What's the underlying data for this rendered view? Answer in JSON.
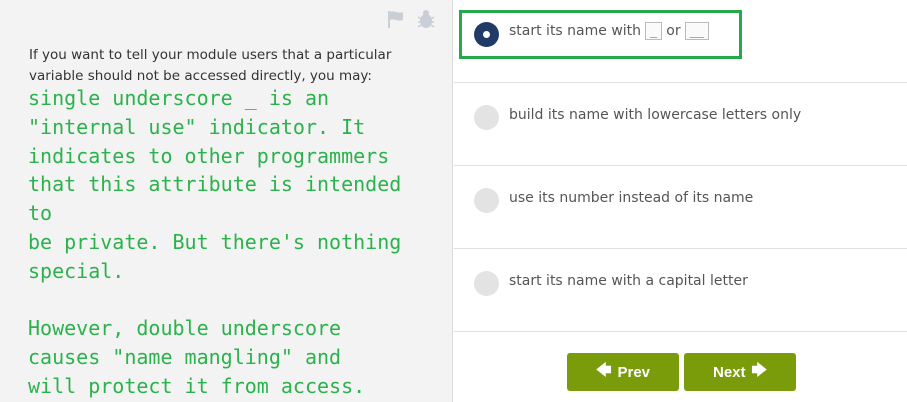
{
  "question": {
    "text": "If you want to tell your module users that a particular variable should not be accessed directly, you may:"
  },
  "annotation": {
    "text": "single underscore _ is an\n\"internal use\" indicator. It\nindicates to other programmers\nthat this attribute is intended to\nbe private. But there's nothing\nspecial.\n\nHowever, double underscore\ncauses \"name mangling\" and\nwill protect it from access.",
    "color": "#2bb24c"
  },
  "toolbar": {
    "flag_icon": "flag-icon",
    "bug_icon": "bug-icon"
  },
  "options": [
    {
      "label": "start its name with",
      "code1": "_",
      "joiner": "or",
      "code2": "__",
      "selected": true
    },
    {
      "label": "build its name with lowercase letters only",
      "selected": false
    },
    {
      "label": "use its number instead of its name",
      "selected": false
    },
    {
      "label": "start its name with a capital letter",
      "selected": false
    }
  ],
  "nav": {
    "prev_label": "Prev",
    "next_label": "Next",
    "button_color": "#7a9c0a"
  },
  "highlight_color": "#27a84a"
}
